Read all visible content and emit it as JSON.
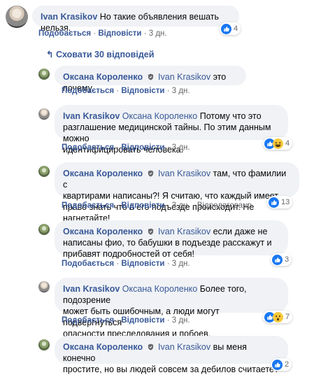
{
  "comments": [
    {
      "author": "Ivan Krasikov",
      "text": "Но такие объявления вешать нельзя.",
      "actions": {
        "like": "Подобається",
        "reply": "Відповісти",
        "time": "3 дн."
      },
      "reactions": {
        "count": "4",
        "icons": [
          "like-icon"
        ]
      }
    },
    {
      "author": "Оксана Короленко",
      "mention": "Ivan Krasikov",
      "text": "это почему",
      "actions": {
        "like": "Подобається",
        "reply": "Відповісти",
        "time": "3 дн."
      }
    },
    {
      "author": "Ivan Krasikov",
      "mention": "Оксана Короленко",
      "text_lines": [
        "Потому что это",
        "разглашение медицинской тайны. По этим данным можно",
        "идентифицировать человека."
      ],
      "actions": {
        "like": "Подобається",
        "reply": "Відповісти",
        "time": "3 дн."
      },
      "reactions": {
        "count": "4",
        "icons": [
          "like-icon",
          "laugh-icon"
        ]
      }
    },
    {
      "author": "Оксана Короленко",
      "mention": "Ivan Krasikov",
      "text_lines": [
        "там, что фамилии с",
        "квартирами написаны?! Я считаю, что каждый имеет",
        "право знать что в его подъезде происходит. Не нагнетайте!"
      ],
      "actions": {
        "like": "Подобається",
        "reply": "Відповісти",
        "time": "3 дн.",
        "edited": "Відредаговано"
      },
      "reactions": {
        "count": "13",
        "icons": [
          "like-icon"
        ]
      }
    },
    {
      "author": "Оксана Короленко",
      "mention": "Ivan Krasikov",
      "text_lines": [
        "если даже не",
        "написаны фио, то бабушки в подъезде расскажут и",
        "прибавят подробностей от себя!"
      ],
      "actions": {
        "like": "Подобається",
        "reply": "Відповісти",
        "time": "3 дн."
      },
      "reactions": {
        "count": "3",
        "icons": [
          "like-icon"
        ]
      }
    },
    {
      "author": "Ivan Krasikov",
      "mention": "Оксана Короленко",
      "text_lines": [
        "Более того, подозрение",
        "может быть ошибочным, а люди могут подвергнуться",
        "опасности преследования и побоев."
      ],
      "actions": {
        "like": "Подобається",
        "reply": "Відповісти",
        "time": "3 дн."
      },
      "reactions": {
        "count": "7",
        "icons": [
          "like-icon",
          "wow-icon"
        ]
      }
    },
    {
      "author": "Оксана Короленко",
      "mention": "Ivan Krasikov",
      "text_lines": [
        "вы меня конечно",
        "простите, но вы людей совсем за дебилов считаете?"
      ],
      "reactions": {
        "count": "2",
        "icons": [
          "like-icon"
        ]
      }
    }
  ],
  "hide_replies": "Сховати 30 відповідей",
  "colors": {
    "link": "#385898",
    "bubble": "#f0f2f5",
    "meta": "#65676b",
    "like": "#1877f2"
  }
}
